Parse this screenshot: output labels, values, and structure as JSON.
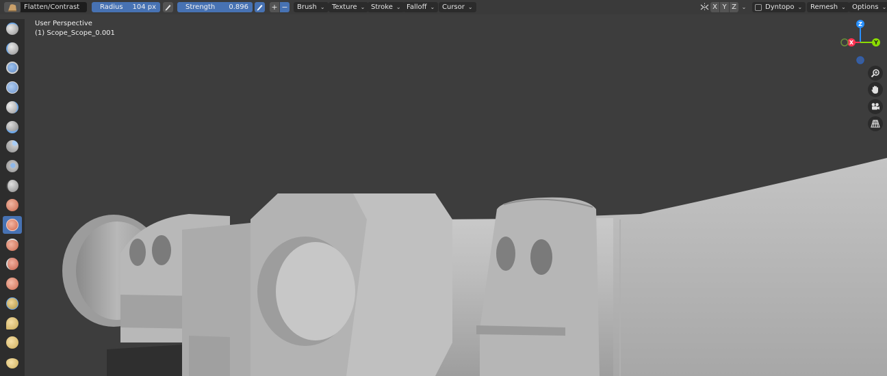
{
  "header": {
    "brush_name": "Flatten/Contrast",
    "radius_label": "Radius",
    "radius_value": "104 px",
    "strength_label": "Strength",
    "strength_value": "0.896",
    "plus": "+",
    "minus": "−",
    "menus": {
      "brush": "Brush",
      "texture": "Texture",
      "stroke": "Stroke",
      "falloff": "Falloff",
      "cursor": "Cursor"
    },
    "axes": {
      "x": "X",
      "y": "Y",
      "z": "Z"
    },
    "dyntopo": "Dyntopo",
    "remesh": "Remesh",
    "options": "Options"
  },
  "viewport": {
    "view_name": "User Perspective",
    "object_name": "(1) Scope_Scope_0.001"
  },
  "gizmo": {
    "x": "X",
    "y": "Y",
    "z": "Z"
  },
  "colors": {
    "accent": "#4772b3",
    "axis_x": "#ff3352",
    "axis_y": "#8bdc00",
    "axis_z": "#2890ff"
  },
  "tools": [
    {
      "name": "draw-brush-icon"
    },
    {
      "name": "draw-sharp-brush-icon"
    },
    {
      "name": "clay-brush-icon"
    },
    {
      "name": "clay-strips-brush-icon"
    },
    {
      "name": "clay-thumb-brush-icon"
    },
    {
      "name": "layer-brush-icon"
    },
    {
      "name": "inflate-brush-icon"
    },
    {
      "name": "blob-brush-icon"
    },
    {
      "name": "crease-brush-icon"
    },
    {
      "name": "smooth-brush-icon"
    },
    {
      "name": "flatten-brush-icon",
      "active": true
    },
    {
      "name": "fill-brush-icon"
    },
    {
      "name": "scrape-brush-icon"
    },
    {
      "name": "multiplane-scrape-brush-icon"
    },
    {
      "name": "pinch-brush-icon"
    },
    {
      "name": "grab-brush-icon"
    },
    {
      "name": "elastic-deform-brush-icon"
    },
    {
      "name": "snake-hook-brush-icon"
    }
  ]
}
